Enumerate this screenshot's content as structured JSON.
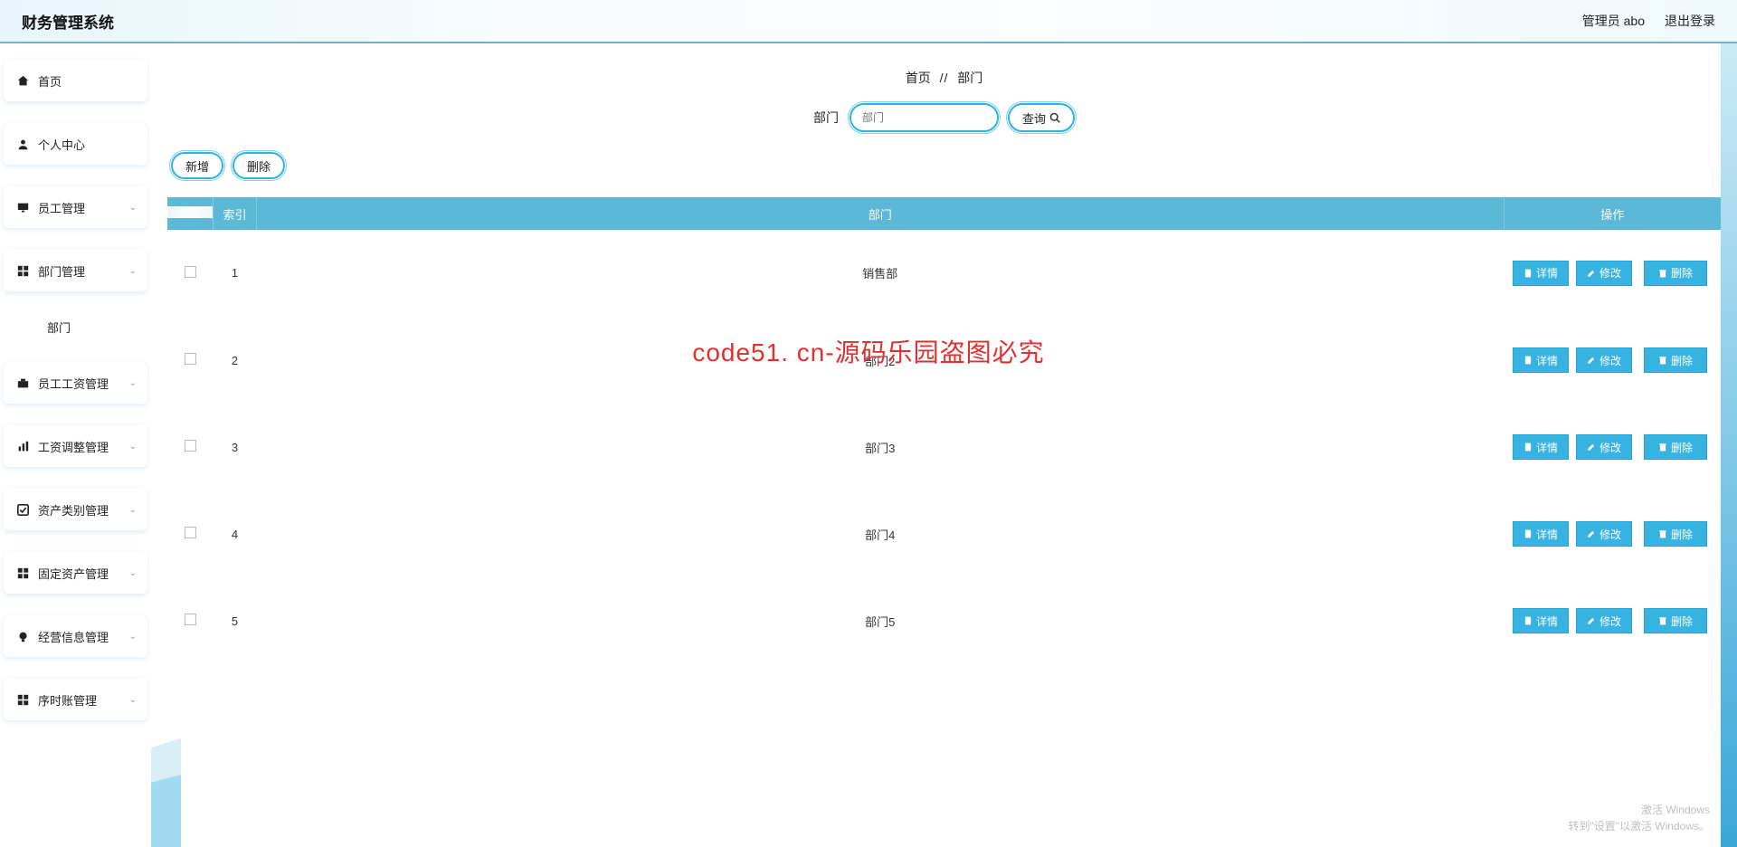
{
  "header": {
    "system_title": "财务管理系统",
    "admin_label": "管理员 abo",
    "logout_label": "退出登录"
  },
  "sidebar": {
    "items": [
      {
        "label": "首页",
        "icon": "home-icon",
        "expandable": false
      },
      {
        "label": "个人中心",
        "icon": "user-icon",
        "expandable": false
      },
      {
        "label": "员工管理",
        "icon": "monitor-icon",
        "expandable": true
      },
      {
        "label": "部门管理",
        "icon": "grid-icon",
        "expandable": true
      },
      {
        "label": "部门",
        "icon": "",
        "expandable": false,
        "sub": true
      },
      {
        "label": "员工工资管理",
        "icon": "briefcase-icon",
        "expandable": true
      },
      {
        "label": "工资调整管理",
        "icon": "bars-icon",
        "expandable": true
      },
      {
        "label": "资产类别管理",
        "icon": "check-icon",
        "expandable": true
      },
      {
        "label": "固定资产管理",
        "icon": "grid-icon",
        "expandable": true
      },
      {
        "label": "经营信息管理",
        "icon": "bulb-icon",
        "expandable": true
      },
      {
        "label": "序时账管理",
        "icon": "grid-icon",
        "expandable": true
      }
    ]
  },
  "breadcrumb": {
    "home": "首页",
    "sep": "//",
    "current": "部门"
  },
  "search": {
    "label": "部门",
    "placeholder": "部门",
    "button": "查询"
  },
  "actions": {
    "add": "新增",
    "delete": "删除"
  },
  "table": {
    "header": {
      "index": "索引",
      "dept": "部门",
      "op": "操作"
    },
    "op_labels": {
      "detail": "详情",
      "edit": "修改",
      "delete": "删除"
    },
    "rows": [
      {
        "index": "1",
        "dept": "销售部"
      },
      {
        "index": "2",
        "dept": "部门2"
      },
      {
        "index": "3",
        "dept": "部门3"
      },
      {
        "index": "4",
        "dept": "部门4"
      },
      {
        "index": "5",
        "dept": "部门5"
      }
    ]
  },
  "watermark": {
    "text": "code51.cn",
    "center": "code51. cn-源码乐园盗图必究"
  },
  "win_activation": {
    "line1": "激活 Windows",
    "line2": "转到\"设置\"以激活 Windows。"
  }
}
